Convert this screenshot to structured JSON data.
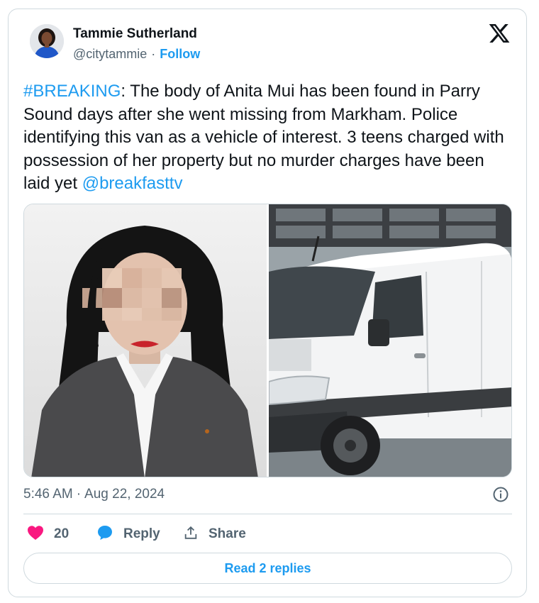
{
  "author": {
    "name": "Tammie Sutherland",
    "handle": "@citytammie",
    "separator": "·",
    "follow_label": "Follow"
  },
  "tweet": {
    "hashtag": "#BREAKING",
    "body": ": The body of Anita Mui has been found in Parry Sound days after she went missing from Markham. Police identifying this van as a vehicle of interest. 3 teens charged with possession of her property but no murder charges have been laid yet ",
    "mention": "@breakfasttv"
  },
  "media": {
    "images": [
      {
        "subject": "woman portrait with blurred face"
      },
      {
        "subject": "white cargo van"
      }
    ]
  },
  "meta": {
    "time": "5:46 AM",
    "separator": "·",
    "date": "Aug 22, 2024"
  },
  "actions": {
    "like_count": "20",
    "reply_label": "Reply",
    "share_label": "Share"
  },
  "read_replies_label": "Read 2 replies",
  "colors": {
    "accent": "#1d9bf0",
    "like": "#f91880",
    "text": "#0f1419",
    "muted": "#536471",
    "border": "#cfd9de"
  },
  "icons": [
    "x-logo-icon",
    "info-icon",
    "heart-icon",
    "reply-bubble-icon",
    "share-icon"
  ]
}
